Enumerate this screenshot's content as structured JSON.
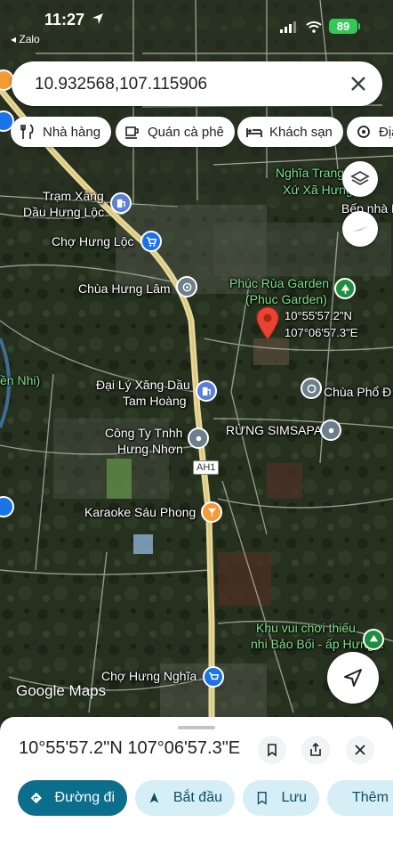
{
  "status_bar": {
    "time": "11:27",
    "back_app": "Zalo",
    "battery": "89"
  },
  "search": {
    "value": "10.932568,107.115906",
    "clear_icon": "close-icon"
  },
  "chips": [
    {
      "label": "Nhà hàng",
      "icon": "restaurant-icon"
    },
    {
      "label": "Quán cà phê",
      "icon": "cafe-icon"
    },
    {
      "label": "Khách sạn",
      "icon": "hotel-icon"
    },
    {
      "label": "Địa",
      "icon": "place-icon"
    }
  ],
  "map": {
    "labels": {
      "nghia_trang_1": "Nghĩa Trang",
      "nghia_trang_2": "Xứ Xã Hưng",
      "bep_nha": "Bếp nhà B",
      "tram_xang_1": "Trạm Xăng",
      "tram_xang_2": "Dầu Hưng Lộc",
      "cho_hung_loc": "Chợ Hưng Lộc",
      "chua_hung_lam": "Chùa Hưng Lâm",
      "phuc_rua_1": "Phúc Rùa Garden",
      "phuc_rua_2": "(Phuc Garden)",
      "pin_lat": "10°55'57.2\"N",
      "pin_lng": "107°06'57.3\"E",
      "yen_nhi": "ền Nhi)",
      "dai_ly_1": "Đại Lý Xăng Dầu",
      "dai_ly_2": "Tam Hoàng",
      "chua_pho_do": "Chùa Phổ Đ",
      "cong_ty_1": "Công Ty Tnhh",
      "cong_ty_2": "Hưng Nhơn",
      "rung_simsapa": "RỪNG SIMSAPA",
      "road_ah1": "AH1",
      "karaoke": "Karaoke Sáu Phong",
      "khu_vui_1": "Khu vui chơi thiếu",
      "khu_vui_2": "nhi Bảo Bối - ấp Hưng...",
      "cho_hung_nghia": "Chợ Hưng Nghĩa"
    },
    "attribution": "Google Maps"
  },
  "sheet": {
    "coords": "10°55'57.2\"N 107°06'57.3\"E",
    "actions": {
      "directions": "Đường đi",
      "start": "Bắt đầu",
      "save": "Lưu",
      "more": "Thêm"
    }
  },
  "colors": {
    "primary": "#0b6e8a",
    "secondary_bg": "#d6eef6",
    "pin": "#ea4335",
    "road": "#e8d89a"
  }
}
